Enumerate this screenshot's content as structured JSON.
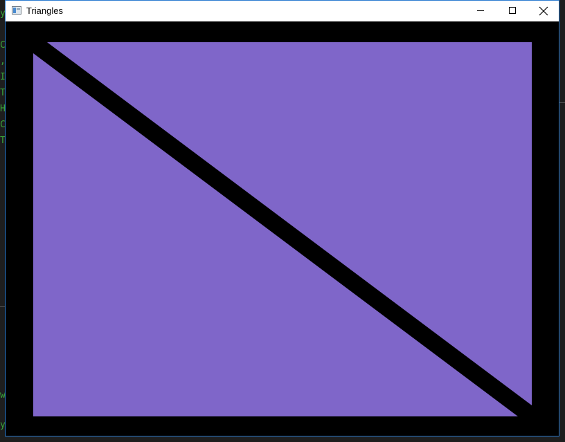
{
  "window": {
    "title": "Triangles",
    "icon": "app-window-icon",
    "controls": {
      "minimize_icon": "minimize-icon",
      "maximize_icon": "maximize-icon",
      "close_icon": "close-icon"
    }
  },
  "scene": {
    "clear_color": "#000000",
    "triangle_color": "#7f66c9",
    "triangle_count": 2
  },
  "background_console": {
    "text_color": "#3aa63a",
    "visible_chars": [
      "y",
      "C",
      ",",
      "I",
      "T",
      "H",
      "C",
      "T",
      "w",
      "y"
    ]
  }
}
